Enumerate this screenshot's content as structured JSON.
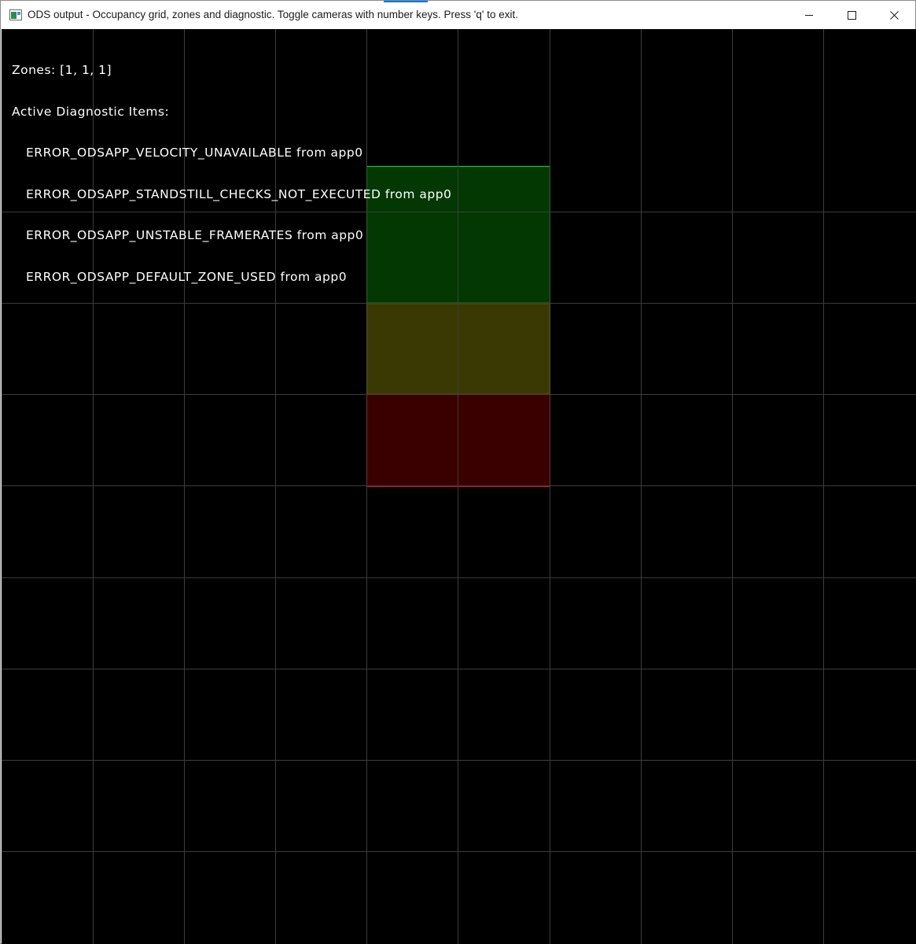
{
  "window": {
    "title": "ODS output - Occupancy grid, zones and diagnostic. Toggle cameras with number keys. Press 'q' to exit.",
    "controls": {
      "minimize_icon": "minimize-icon",
      "maximize_icon": "maximize-icon",
      "close_icon": "close-icon"
    }
  },
  "overlay": {
    "zones_text": "Zones: [1, 1, 1]",
    "diagnostics_heading": "Active Diagnostic Items:",
    "diagnostic_items": [
      "ERROR_ODSAPP_VELOCITY_UNAVAILABLE from app0",
      "ERROR_ODSAPP_STANDSTILL_CHECKS_NOT_EXECUTED from app0",
      "ERROR_ODSAPP_UNSTABLE_FRAMERATES from app0",
      "ERROR_ODSAPP_DEFAULT_ZONE_USED from app0"
    ]
  },
  "zones": [
    {
      "name": "green-zone",
      "fill": "#033803",
      "stroke": "#1fc21f"
    },
    {
      "name": "yellow-zone",
      "fill": "#3a3904",
      "stroke": "#c8c81a"
    },
    {
      "name": "red-zone",
      "fill": "#3a0000",
      "stroke": "#c01818"
    }
  ],
  "colors": {
    "background": "#000000",
    "grid_line": "#3c3c3c",
    "text": "#ffffff",
    "title_accent": "#0078d7"
  }
}
